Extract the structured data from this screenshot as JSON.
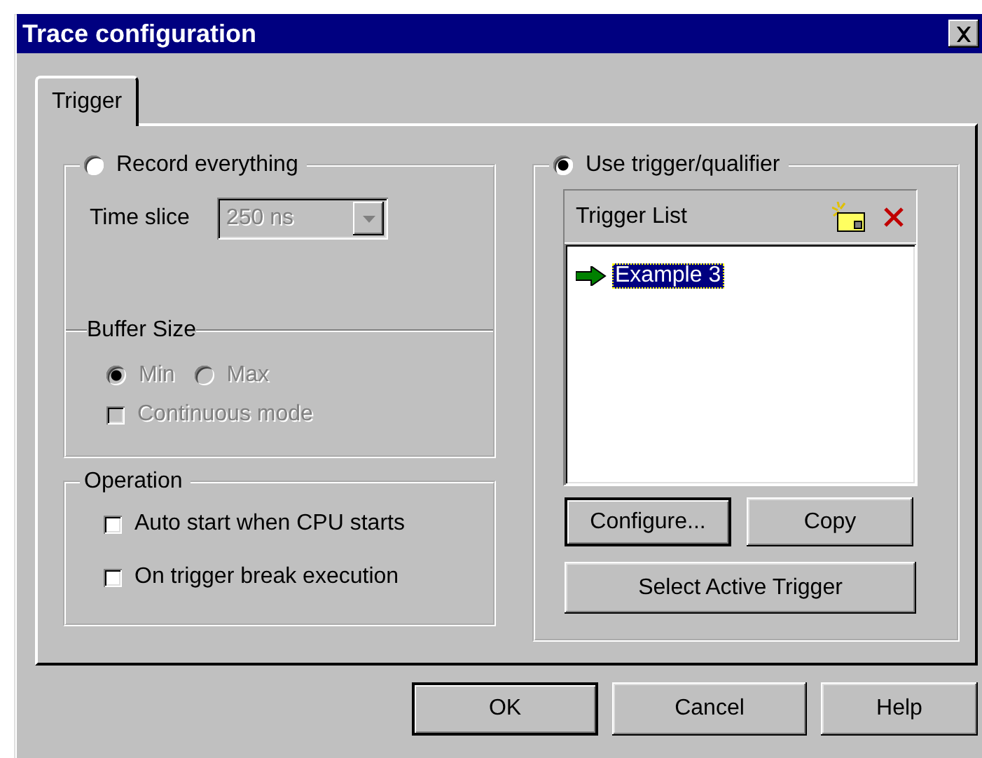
{
  "window": {
    "title": "Trace configuration"
  },
  "tabs": [
    {
      "label": "Trigger",
      "selected": true
    }
  ],
  "record_group": {
    "label": "Record everything",
    "selected": false,
    "time_slice": {
      "label": "Time slice",
      "value": "250 ns",
      "disabled": true
    },
    "buffer_size": {
      "label": "Buffer Size",
      "disabled": true,
      "options": [
        {
          "label": "Min",
          "selected": true
        },
        {
          "label": "Max",
          "selected": false
        }
      ]
    },
    "continuous_mode": {
      "label": "Continuous mode",
      "checked": false,
      "disabled": true
    }
  },
  "operation": {
    "label": "Operation",
    "options": [
      {
        "label": "Auto start when CPU starts",
        "checked": false
      },
      {
        "label": "On trigger break execution",
        "checked": false
      }
    ]
  },
  "trigger_group": {
    "label": "Use trigger/qualifier",
    "selected": true,
    "list_title": "Trigger List",
    "items": [
      {
        "label": "Example 3",
        "active": true,
        "selected": true
      }
    ],
    "buttons": [
      {
        "label": "Configure...",
        "default": true
      },
      {
        "label": "Copy",
        "default": false
      }
    ],
    "wide_button": "Select Active Trigger"
  },
  "buttons": [
    {
      "label": "OK",
      "default": true
    },
    {
      "label": "Cancel",
      "default": false
    },
    {
      "label": "Help",
      "default": false
    }
  ]
}
